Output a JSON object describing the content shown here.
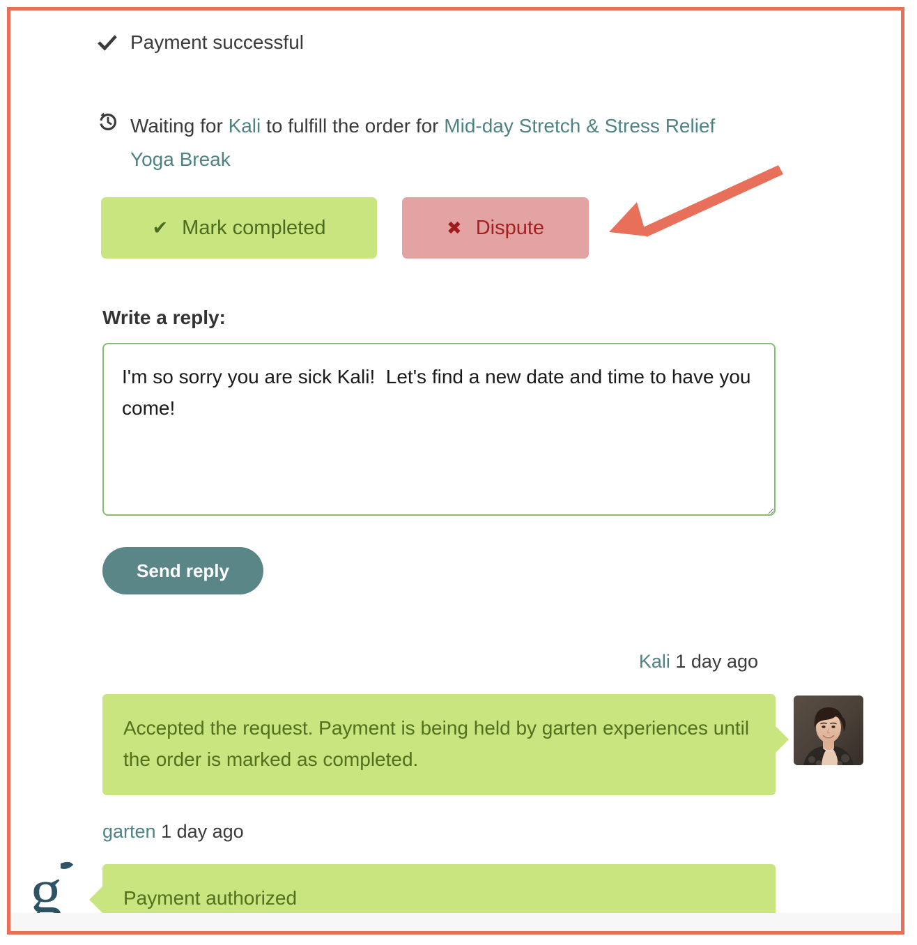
{
  "colors": {
    "annotation": "#E8705A",
    "link": "#4F8383",
    "bubble_green": "#C9E57F",
    "bubble_text": "#51711F",
    "button_green": "#C9E57F",
    "button_green_text": "#4B6B1E",
    "button_pink": "#E3A3A3",
    "button_pink_text": "#A52020",
    "send_button": "#5B8687",
    "textarea_border": "#85BE6E",
    "logo": "#2E5266"
  },
  "status": {
    "payment": {
      "icon": "check-icon",
      "text": "Payment successful"
    },
    "waiting": {
      "icon": "history-clock-icon",
      "prefix": "Waiting for ",
      "actor": "Kali",
      "middle": " to fulfill the order for ",
      "order": "Mid-day Stretch & Stress Relief Yoga Break"
    }
  },
  "actions": {
    "mark_completed": {
      "label": "Mark completed",
      "icon": "check-icon",
      "glyph": "✔"
    },
    "dispute": {
      "label": "Dispute",
      "icon": "cross-icon",
      "glyph": "✖"
    }
  },
  "composer": {
    "label": "Write a reply:",
    "value": "I'm so sorry you are sick Kali!  Let's find a new date and time to have you come!",
    "placeholder": "",
    "send_label": "Send reply"
  },
  "thread": [
    {
      "author": "Kali",
      "timestamp": "1 day ago",
      "direction": "inbound",
      "text": "Accepted the request. Payment is being held by garten experiences until the order is marked as completed.",
      "avatar": "kali-photo-avatar"
    },
    {
      "author": "garten",
      "timestamp": "1 day ago",
      "direction": "outbound",
      "text": "Payment authorized",
      "avatar": "garten-logo-avatar"
    }
  ],
  "annotation": {
    "type": "arrow",
    "points_to": "dispute-button",
    "color": "#E8705A"
  }
}
